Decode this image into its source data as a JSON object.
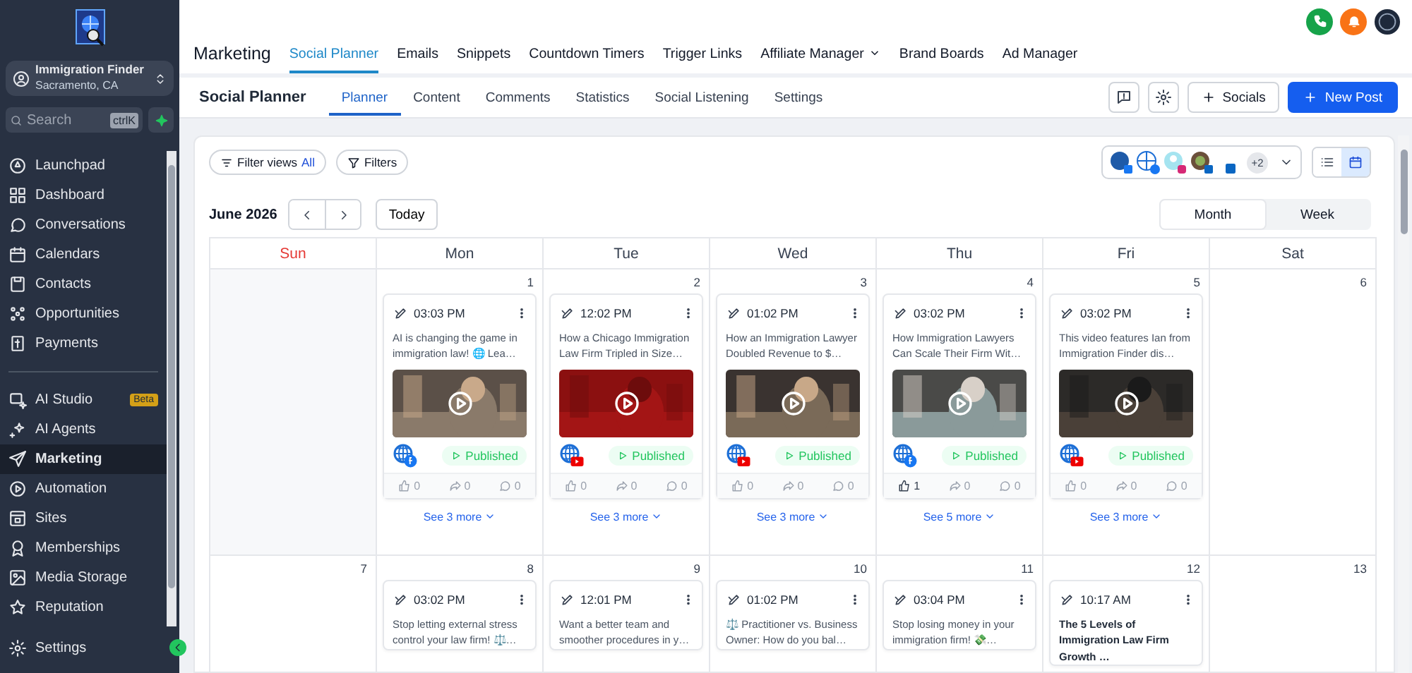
{
  "sidebar": {
    "account": {
      "name": "Immigration Finder",
      "location": "Sacramento, CA"
    },
    "search": {
      "placeholder": "Search",
      "shortcut": "ctrlK"
    },
    "groups": [
      [
        {
          "label": "Launchpad",
          "selected": false
        },
        {
          "label": "Dashboard",
          "selected": false
        },
        {
          "label": "Conversations",
          "selected": false
        },
        {
          "label": "Calendars",
          "selected": false
        },
        {
          "label": "Contacts",
          "selected": false
        },
        {
          "label": "Opportunities",
          "selected": false
        },
        {
          "label": "Payments",
          "selected": false
        }
      ],
      [
        {
          "label": "AI Studio",
          "badge": "Beta",
          "selected": false
        },
        {
          "label": "AI Agents",
          "selected": false
        },
        {
          "label": "Marketing",
          "selected": true
        },
        {
          "label": "Automation",
          "selected": false
        },
        {
          "label": "Sites",
          "selected": false
        },
        {
          "label": "Memberships",
          "selected": false
        },
        {
          "label": "Media Storage",
          "selected": false
        },
        {
          "label": "Reputation",
          "selected": false
        }
      ]
    ],
    "footer": "Settings"
  },
  "top_nav": {
    "title": "Marketing",
    "tabs": [
      {
        "label": "Social Planner",
        "selected": true,
        "dropdown": false
      },
      {
        "label": "Emails",
        "selected": false,
        "dropdown": false
      },
      {
        "label": "Snippets",
        "selected": false,
        "dropdown": false
      },
      {
        "label": "Countdown Timers",
        "selected": false,
        "dropdown": false
      },
      {
        "label": "Trigger Links",
        "selected": false,
        "dropdown": false
      },
      {
        "label": "Affiliate Manager",
        "selected": false,
        "dropdown": true
      },
      {
        "label": "Brand Boards",
        "selected": false,
        "dropdown": false
      },
      {
        "label": "Ad Manager",
        "selected": false,
        "dropdown": false
      }
    ]
  },
  "sub_nav": {
    "title": "Social Planner",
    "tabs": [
      {
        "label": "Planner",
        "selected": true
      },
      {
        "label": "Content",
        "selected": false
      },
      {
        "label": "Comments",
        "selected": false
      },
      {
        "label": "Statistics",
        "selected": false
      },
      {
        "label": "Social Listening",
        "selected": false
      },
      {
        "label": "Settings",
        "selected": false
      }
    ],
    "socials_button": "Socials",
    "new_post_button": "New Post"
  },
  "filters": {
    "filter_views": "Filter views",
    "filter_views_value": "All",
    "filters_button": "Filters",
    "accounts_more": "+2",
    "views": [
      {
        "selected": false
      },
      {
        "selected": true
      }
    ]
  },
  "calendar": {
    "month": "June 2026",
    "today_button": "Today",
    "modes": [
      {
        "label": "Month",
        "selected": true
      },
      {
        "label": "Week",
        "selected": false
      }
    ],
    "days": [
      {
        "label": "Sun",
        "color": "#e53935"
      },
      {
        "label": "Mon",
        "color": "#374151"
      },
      {
        "label": "Tue",
        "color": "#374151"
      },
      {
        "label": "Wed",
        "color": "#374151"
      },
      {
        "label": "Thu",
        "color": "#374151"
      },
      {
        "label": "Fri",
        "color": "#374151"
      },
      {
        "label": "Sat",
        "color": "#374151"
      }
    ],
    "weeks": [
      [
        {
          "kind": "outside_month"
        },
        {
          "date": "1",
          "more": "See 3 more",
          "posts": [
            {
              "time": "03:03 PM",
              "text": "AI is changing the game in immigration law! 🌐 Lea…",
              "bold": false,
              "kind": "facebook",
              "status": "Published",
              "likes": "0",
              "shares": "0",
              "comments": "0"
            }
          ]
        },
        {
          "date": "2",
          "more": "See 3 more",
          "posts": [
            {
              "time": "12:02 PM",
              "text": "How a Chicago Immigration Law Firm Tripled in Size…",
              "bold": false,
              "kind": "youtube",
              "status": "Published",
              "likes": "0",
              "shares": "0",
              "comments": "0"
            }
          ]
        },
        {
          "date": "3",
          "more": "See 3 more",
          "posts": [
            {
              "time": "01:02 PM",
              "text": "How an Immigration Lawyer Doubled Revenue to $…",
              "bold": false,
              "kind": "youtube",
              "status": "Published",
              "likes": "0",
              "shares": "0",
              "comments": "0"
            }
          ]
        },
        {
          "date": "4",
          "more": "See 5 more",
          "posts": [
            {
              "time": "03:02 PM",
              "text": "How Immigration Lawyers Can Scale Their Firm Wit…",
              "bold": false,
              "kind": "facebook",
              "status": "Published",
              "likes": "1",
              "shares": "0",
              "comments": "0"
            }
          ]
        },
        {
          "date": "5",
          "more": "See 3 more",
          "posts": [
            {
              "time": "03:02 PM",
              "text": "This video features Ian from Immigration Finder dis…",
              "bold": false,
              "kind": "youtube",
              "status": "Published",
              "likes": "0",
              "shares": "0",
              "comments": "0"
            }
          ]
        },
        {
          "date": "6"
        }
      ],
      [
        {
          "date": "7"
        },
        {
          "date": "8",
          "posts": [
            {
              "time": "03:02 PM",
              "text": "Stop letting external stress control your law firm! ⚖️…",
              "bold": false
            }
          ]
        },
        {
          "date": "9",
          "posts": [
            {
              "time": "12:01 PM",
              "text": "Want a better team and smoother procedures in y…",
              "bold": false
            }
          ]
        },
        {
          "date": "10",
          "posts": [
            {
              "time": "01:02 PM",
              "text": "⚖️ Practitioner vs. Business Owner: How do you bal…",
              "bold": false
            }
          ]
        },
        {
          "date": "11",
          "posts": [
            {
              "time": "03:04 PM",
              "text": "Stop losing money in your immigration firm! 💸…",
              "bold": false
            }
          ]
        },
        {
          "date": "12",
          "posts": [
            {
              "time": "10:17 AM",
              "text": "The 5 Levels of Immigration Law Firm Growth …",
              "bold": true
            }
          ]
        },
        {
          "date": "13"
        }
      ]
    ]
  }
}
